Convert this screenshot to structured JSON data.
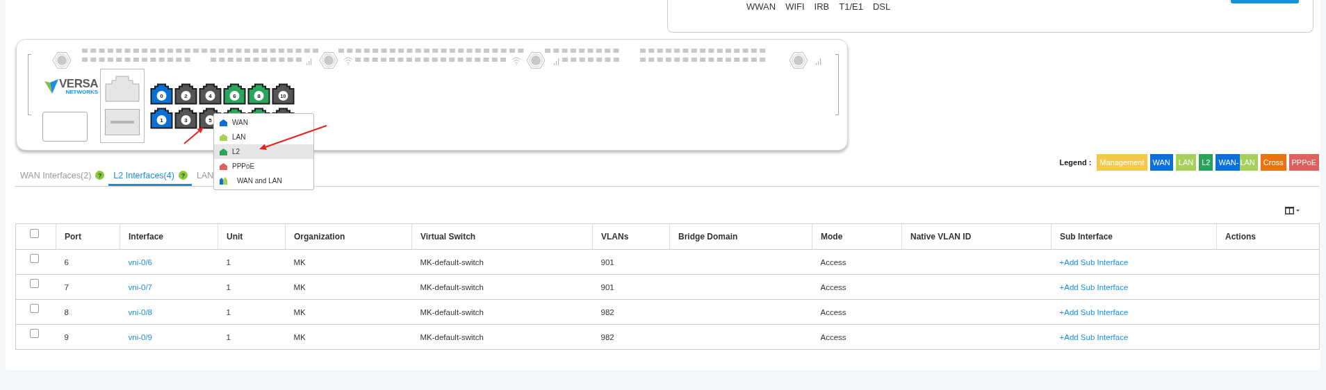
{
  "top_panel": {
    "options": [
      "WWAN",
      "WIFI",
      "IRB",
      "T1/E1",
      "DSL"
    ]
  },
  "device": {
    "logo": {
      "name": "VERSA",
      "tagline": "NETWORKS"
    },
    "port_rows": [
      [
        {
          "label": "0",
          "color": "#0b6fd8"
        },
        {
          "label": "2",
          "color": "#555555"
        },
        {
          "label": "4",
          "color": "#555555"
        },
        {
          "label": "6",
          "color": "#2aa55c"
        },
        {
          "label": "8",
          "color": "#2aa55c"
        },
        {
          "label": "10",
          "color": "#555555"
        }
      ],
      [
        {
          "label": "1",
          "color": "#0b6fd8"
        },
        {
          "label": "3",
          "color": "#555555"
        },
        {
          "label": "5",
          "color": "#555555"
        },
        {
          "color": "#2aa55c"
        },
        {
          "color": "#2aa55c"
        },
        {
          "color": "#555555"
        }
      ]
    ]
  },
  "port_menu": {
    "items": [
      {
        "label": "WAN",
        "kind": "single",
        "color": "#0b6fd8",
        "selected": false
      },
      {
        "label": "LAN",
        "kind": "single",
        "color": "#a6d05a",
        "selected": false
      },
      {
        "label": "L2",
        "kind": "single",
        "color": "#2aa55c",
        "selected": true
      },
      {
        "label": "PPPoE",
        "kind": "single",
        "color": "#e0605e",
        "selected": false
      },
      {
        "label": "WAN and LAN",
        "kind": "combo",
        "segments": [
          {
            "color": "#0b6fd8"
          },
          {
            "color": "#a6d05a"
          }
        ],
        "selected": false
      }
    ]
  },
  "tabs": [
    {
      "label": "WAN Interfaces(2)",
      "badge": "?",
      "selected": false
    },
    {
      "label": "L2 Interfaces(4)",
      "badge": "?",
      "selected": true
    },
    {
      "label": "LAN",
      "selected": false
    }
  ],
  "legend": {
    "title": "Legend :",
    "items": [
      {
        "label": "Management",
        "kind": "single",
        "color": "#f3c94b"
      },
      {
        "label": "WAN",
        "kind": "single",
        "color": "#0b70d9"
      },
      {
        "label": "LAN",
        "kind": "single",
        "color": "#a6d05a"
      },
      {
        "label": "L2",
        "kind": "single",
        "color": "#27a35a"
      },
      {
        "kind": "split",
        "segments": [
          {
            "label": "WAN-",
            "color": "#0b70d9"
          },
          {
            "label": "LAN",
            "color": "#a6d05a"
          }
        ]
      },
      {
        "label": "Cross",
        "kind": "single",
        "color": "#e9730f"
      },
      {
        "label": "PPPoE",
        "kind": "single",
        "color": "#e0605e"
      }
    ]
  },
  "table": {
    "header_checked": false,
    "columns": [
      "Port",
      "Interface",
      "Unit",
      "Organization",
      "Virtual Switch",
      "VLANs",
      "Bridge Domain",
      "Mode",
      "Native VLAN ID",
      "Sub Interface",
      "Actions"
    ],
    "rows": [
      {
        "checked": false,
        "port": "6",
        "interface": "vni-0/6",
        "unit": "1",
        "organization": "MK",
        "virtual_switch": "MK-default-switch",
        "vlans": "901",
        "mode": "Access",
        "sub_interface": "+Add Sub Interface"
      },
      {
        "checked": false,
        "port": "7",
        "interface": "vni-0/7",
        "unit": "1",
        "organization": "MK",
        "virtual_switch": "MK-default-switch",
        "vlans": "901",
        "mode": "Access",
        "sub_interface": "+Add Sub Interface"
      },
      {
        "checked": false,
        "port": "8",
        "interface": "vni-0/8",
        "unit": "1",
        "organization": "MK",
        "virtual_switch": "MK-default-switch",
        "vlans": "982",
        "mode": "Access",
        "sub_interface": "+Add Sub Interface"
      },
      {
        "checked": false,
        "port": "9",
        "interface": "vni-0/9",
        "unit": "1",
        "organization": "MK",
        "virtual_switch": "MK-default-switch",
        "vlans": "982",
        "mode": "Access",
        "sub_interface": "+Add Sub Interface"
      }
    ]
  }
}
